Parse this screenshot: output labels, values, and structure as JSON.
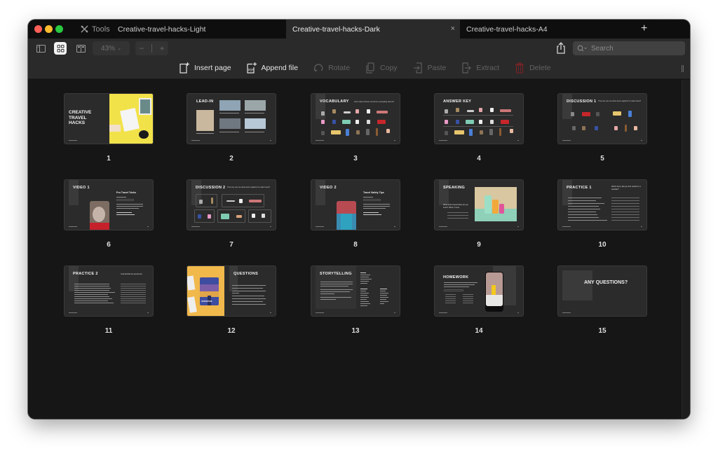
{
  "window": {
    "tools_label": "Tools",
    "tabs": [
      {
        "label": "Creative-travel-hacks-Light",
        "active": false
      },
      {
        "label": "Creative-travel-hacks-Dark",
        "active": true,
        "close": "×"
      },
      {
        "label": "Creative-travel-hacks-A4",
        "active": false
      }
    ],
    "new_tab": "+"
  },
  "toolbar": {
    "zoom_level": "43%",
    "zoom_out": "−",
    "zoom_in": "+",
    "search_placeholder": "Search",
    "actions": [
      {
        "label": "Insert page",
        "icon": "insert-page-icon",
        "enabled": true
      },
      {
        "label": "Append file",
        "icon": "append-pdf-icon",
        "enabled": true
      },
      {
        "label": "Rotate",
        "icon": "rotate-icon",
        "enabled": false
      },
      {
        "label": "Copy",
        "icon": "copy-icon",
        "enabled": false
      },
      {
        "label": "Paste",
        "icon": "paste-icon",
        "enabled": false
      },
      {
        "label": "Extract",
        "icon": "extract-icon",
        "enabled": false
      },
      {
        "label": "Delete",
        "icon": "trash-icon",
        "enabled": false
      }
    ]
  },
  "pages": [
    {
      "number": "1",
      "title": "CREATIVE TRAVEL HACKS"
    },
    {
      "number": "2",
      "title": "LEAD-IN"
    },
    {
      "number": "3",
      "title": "VOCABULARY",
      "subtitle": "Can name these common everyday items?"
    },
    {
      "number": "4",
      "title": "ANSWER KEY"
    },
    {
      "number": "5",
      "title": "DISCUSSION 1",
      "subtitle": "How can you use these items together for safer travel?"
    },
    {
      "number": "6",
      "title": "VIDEO 1",
      "subtitle": "Pro Travel Tricks"
    },
    {
      "number": "7",
      "title": "DISCUSSION 2",
      "subtitle": "How can you use these items together for safer travel?"
    },
    {
      "number": "8",
      "title": "VIDEO 2",
      "subtitle": "Travel Safety Tips"
    },
    {
      "number": "9",
      "title": "SPEAKING",
      "subtitle": "What other travel hacks do you know? Write 3 more."
    },
    {
      "number": "10",
      "title": "PRACTICE 1",
      "subtitle": "Which items did you find useful for a traveller?"
    },
    {
      "number": "11",
      "title": "PRACTICE 2",
      "subtitle": "Unscramble the sentences"
    },
    {
      "number": "12",
      "title": "QUESTIONS",
      "cover_text": "ADVENTURE"
    },
    {
      "number": "13",
      "title": "STORYTELLING"
    },
    {
      "number": "14",
      "title": "HOMEWORK"
    },
    {
      "number": "15",
      "title": "ANY QUESTIONS?"
    }
  ],
  "colors": {
    "accent_yellow": "#f2e24a",
    "delete_red": "#b3282d",
    "window_bg": "#161616",
    "toolbar_bg": "#2a2a2a"
  }
}
